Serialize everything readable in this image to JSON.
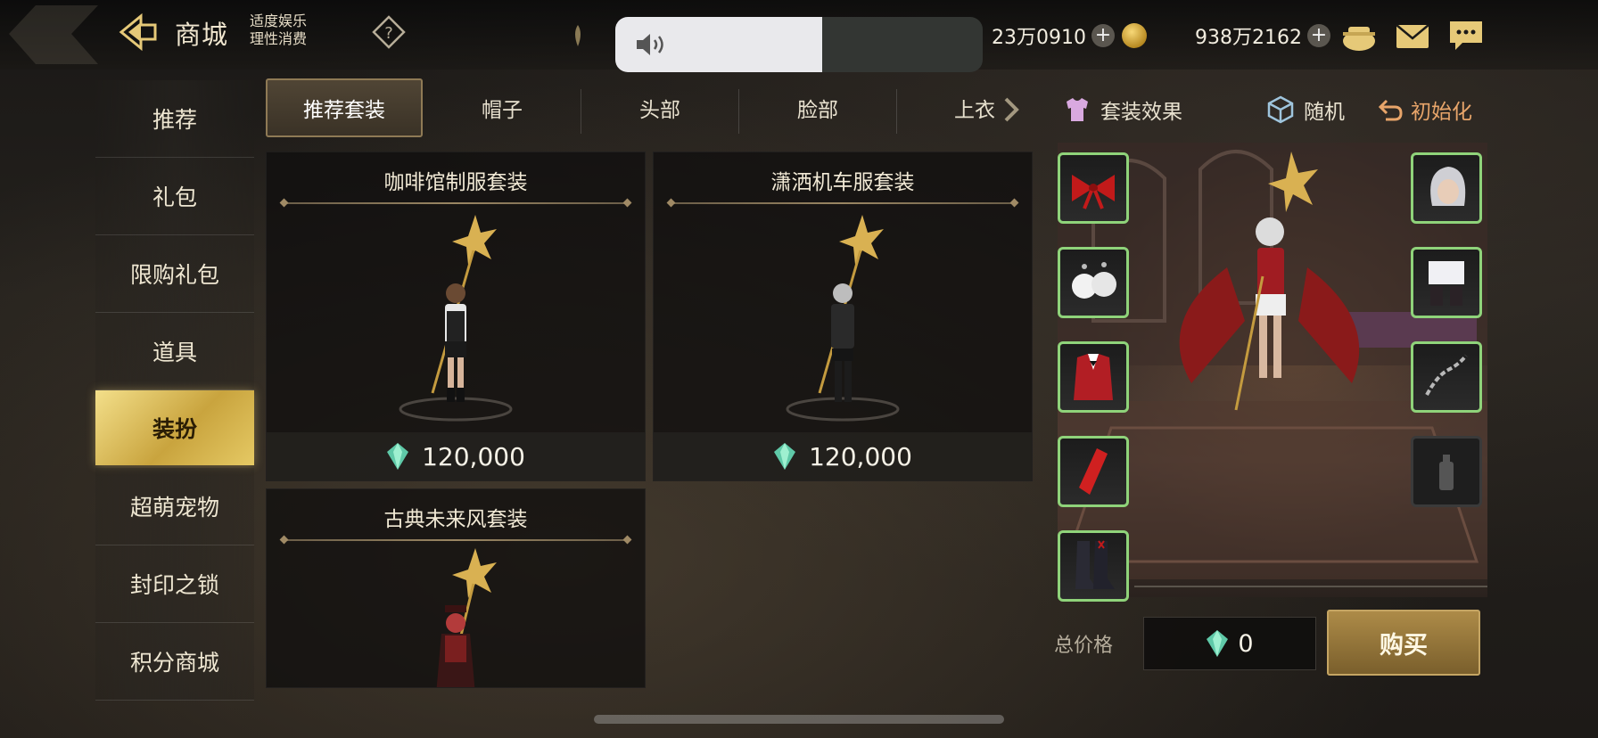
{
  "header": {
    "title": "商城",
    "notice_line1": "适度娱乐",
    "notice_line2": "理性消费",
    "currency1": "23万0910",
    "currency2": "938万2162",
    "icons": [
      "back-arrow-icon",
      "help-icon",
      "volume-icon",
      "diamond-icon",
      "coin-icon",
      "pot-icon",
      "mail-icon",
      "chat-icon"
    ]
  },
  "sidebar": {
    "items": [
      {
        "label": "推荐"
      },
      {
        "label": "礼包"
      },
      {
        "label": "限购礼包"
      },
      {
        "label": "道具"
      },
      {
        "label": "装扮",
        "active": true
      },
      {
        "label": "超萌宠物"
      },
      {
        "label": "封印之锁"
      },
      {
        "label": "积分商城"
      }
    ]
  },
  "tabs": [
    {
      "label": "推荐套装",
      "active": true
    },
    {
      "label": "帽子"
    },
    {
      "label": "头部"
    },
    {
      "label": "脸部"
    },
    {
      "label": "上衣"
    }
  ],
  "cards": [
    {
      "title": "咖啡馆制服套装",
      "price": "120,000"
    },
    {
      "title": "潇洒机车服套装",
      "price": "120,000"
    },
    {
      "title": "古典未来风套装"
    }
  ],
  "panel": {
    "suit_effect": "套装效果",
    "random": "随机",
    "reset": "初始化",
    "total_label": "总价格",
    "total_value": "0",
    "buy": "购买"
  },
  "colors": {
    "accent_gold": "#c9a43e",
    "slot_border": "#8fd37a",
    "reset_orange": "#e8a56a"
  }
}
